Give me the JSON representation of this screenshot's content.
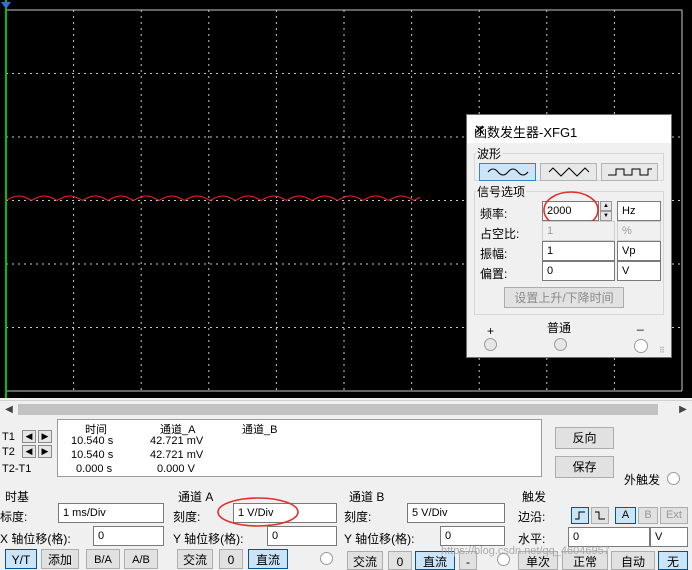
{
  "cursors": {
    "t1_label": "T1",
    "t2_label": "T2",
    "t2t1_label": "T2-T1",
    "col_time": "时间",
    "col_a": "通道_A",
    "col_b": "通道_B",
    "rows": [
      {
        "time": "10.540 s",
        "a": "42.721 mV",
        "b": ""
      },
      {
        "time": "10.540 s",
        "a": "42.721 mV",
        "b": ""
      },
      {
        "time": "0.000 s",
        "a": "0.000 V",
        "b": ""
      }
    ]
  },
  "side_buttons": {
    "reverse": "反向",
    "save": "保存",
    "ext_trigger": "外触发"
  },
  "timebase": {
    "title": "时基",
    "scale_label": "标度:",
    "scale_value": "1 ms/Div",
    "xpos_label": "X 轴位移(格):",
    "xpos_value": "0",
    "btn_yt": "Y/T",
    "btn_add": "添加",
    "btn_ba": "B/A",
    "btn_ab": "A/B"
  },
  "channel_a": {
    "title": "通道 A",
    "scale_label": "刻度:",
    "scale_value": "1  V/Div",
    "ypos_label": "Y 轴位移(格):",
    "ypos_value": "0",
    "btn_ac": "交流",
    "btn_zero": "0",
    "btn_dc": "直流"
  },
  "channel_b": {
    "title": "通道 B",
    "scale_label": "刻度:",
    "scale_value": "5  V/Div",
    "ypos_label": "Y 轴位移(格):",
    "ypos_value": "0",
    "btn_ac": "交流",
    "btn_zero": "0",
    "btn_dc": "直流",
    "btn_minus": "-"
  },
  "trigger": {
    "title": "触发",
    "edge_label": "边沿:",
    "level_label": "水平:",
    "level_value": "0",
    "level_unit": "V",
    "btn_a": "A",
    "btn_b": "B",
    "btn_ext": "Ext",
    "btn_single": "单次",
    "btn_normal": "正常",
    "btn_auto": "自动",
    "btn_none": "无"
  },
  "watermark": "https://blog.csdn.net/qq_46046957",
  "fgen": {
    "title": "函数发生器-XFG1",
    "close": "✕",
    "waveform_label": "波形",
    "signal_options_label": "信号选项",
    "freq_label": "频率:",
    "freq_value": "2000",
    "freq_unit": "Hz",
    "duty_label": "占空比:",
    "duty_value": "1",
    "duty_unit": "%",
    "amp_label": "振幅:",
    "amp_value": "1",
    "amp_unit": "Vp",
    "offset_label": "偏置:",
    "offset_value": "0",
    "offset_unit": "V",
    "rise_fall_button": "设置上升/下降时间",
    "plus_label": "+",
    "common_label": "普通",
    "minus_label": "_"
  },
  "colors": {
    "screen": "#000000",
    "grid": "#c8c8c8",
    "trace": "#ff2020",
    "highlight": "#e0302a",
    "selected": "#cce4f7"
  }
}
